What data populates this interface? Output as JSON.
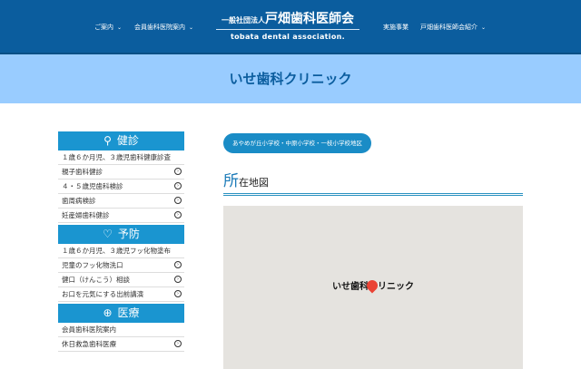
{
  "header": {
    "nav_left": [
      {
        "label": "ご案内"
      },
      {
        "label": "会員歯科医院案内"
      }
    ],
    "nav_right": [
      {
        "label": "実施事業"
      },
      {
        "label": "戸畑歯科医師会紹介"
      }
    ],
    "logo_prefix": "一般社団法人",
    "logo_main": "戸畑歯科医師会",
    "logo_en": "tobata dental association."
  },
  "page_title": "いせ歯科クリニック",
  "sidebar": {
    "categories": [
      {
        "label": "健診",
        "icon": "search-icon",
        "items": [
          "１歳６か月児、３歳児歯科健康診査",
          "親子歯科健診",
          "４・５歳児歯科検診",
          "歯周病検診",
          "妊産婦歯科健診"
        ]
      },
      {
        "label": "予防",
        "icon": "heart-icon",
        "items": [
          "１歳６か月児、３歳児フッ化物塗布",
          "児童のフッ化物洗口",
          "健口（けんこう）相談",
          "お口を元気にする出前講演"
        ]
      },
      {
        "label": "医療",
        "icon": "plus-icon",
        "items": [
          "会員歯科医院案内",
          "休日救急歯科医療"
        ]
      }
    ]
  },
  "main": {
    "district": "あやめが丘小学校・中原小学校・一枝小学校地区",
    "section_first": "所",
    "section_rest": "在地図",
    "map_label": "いせ歯科クリニック"
  },
  "colors": {
    "header": "#0b5d9e",
    "band": "#99ccff",
    "accent": "#1a95d0"
  }
}
